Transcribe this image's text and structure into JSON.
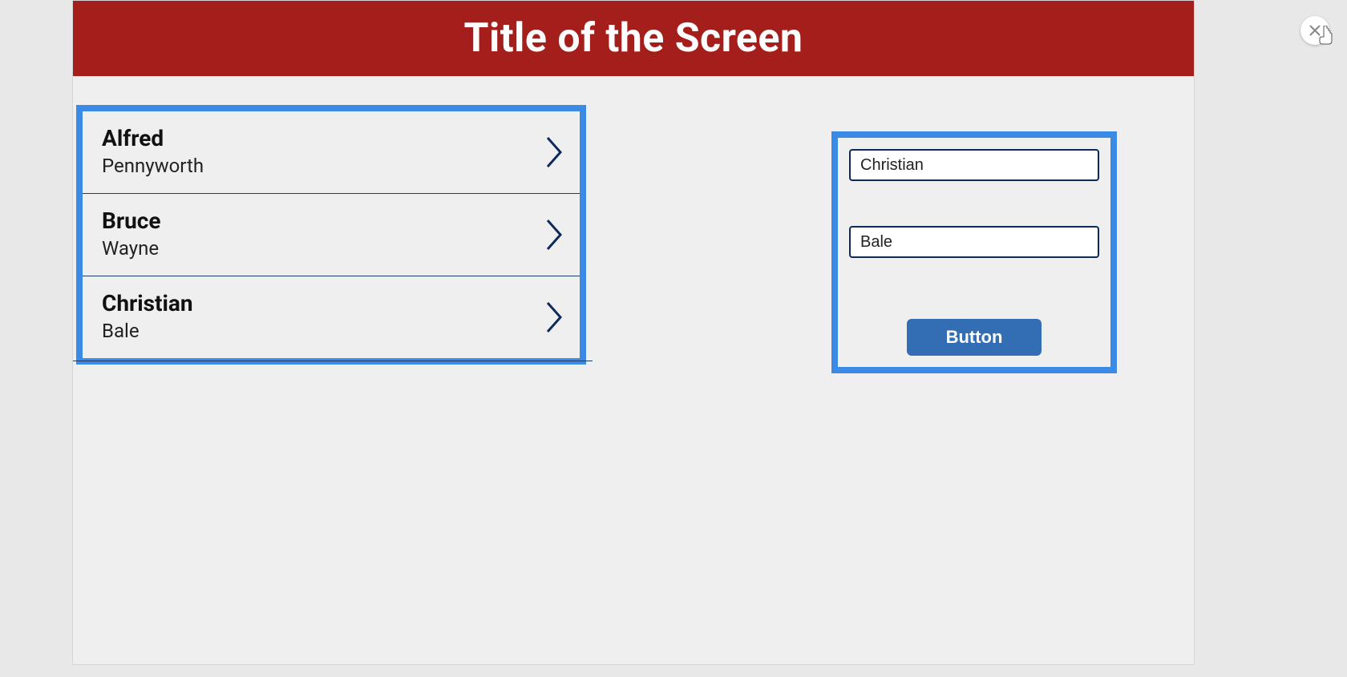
{
  "header": {
    "title": "Title of the Screen"
  },
  "list": {
    "items": [
      {
        "primary": "Alfred",
        "secondary": "Pennyworth"
      },
      {
        "primary": "Bruce",
        "secondary": "Wayne"
      },
      {
        "primary": "Christian",
        "secondary": "Bale"
      }
    ]
  },
  "form": {
    "input1_value": "Christian",
    "input2_value": "Bale",
    "button_label": "Button"
  },
  "colors": {
    "header_bg": "#a41f1c",
    "highlight_border": "#3b8be6",
    "input_border": "#0e2a5a",
    "button_bg": "#336eb4"
  }
}
